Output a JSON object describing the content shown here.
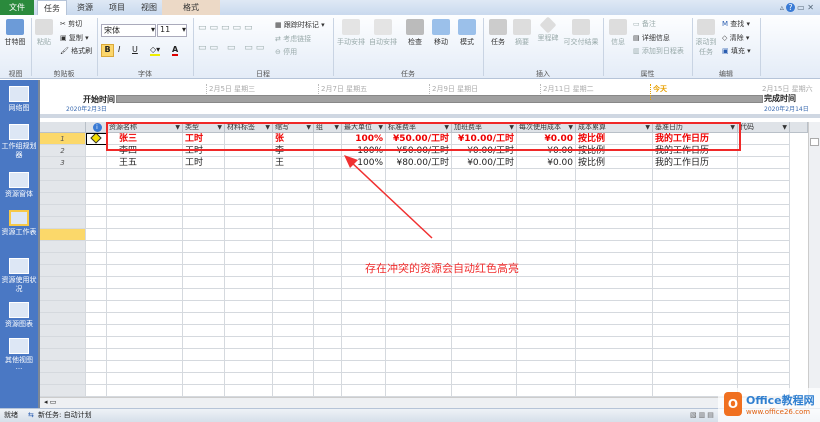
{
  "tabs": [
    "文件",
    "任务",
    "资源",
    "项目",
    "视图",
    "格式"
  ],
  "ribbon": {
    "gantt": "甘特图",
    "paste": "粘贴",
    "cut": "剪切",
    "copy": "复制",
    "format_painter": "格式刷",
    "font_name": "宋体",
    "font_size": "11",
    "bold": "B",
    "italic": "I",
    "underline": "U",
    "font_color": "A",
    "track": "跟踪时标记",
    "respect_links": "考虑链接",
    "inactivate": "停用",
    "manual": "手动安排",
    "auto": "自动安排",
    "inspect": "检查",
    "move": "移动",
    "mode": "模式",
    "task": "任务",
    "summary": "摘要",
    "milestone": "里程碑",
    "deliverable": "可交付结果",
    "info": "信息",
    "notes": "备注",
    "details": "详细信息",
    "add_timeline": "添加到日程表",
    "scroll_to": "滚动到任务",
    "find": "查找",
    "clear": "清除",
    "fill": "填充",
    "groups": [
      "视图",
      "剪贴板",
      "字体",
      "日程",
      "任务",
      "插入",
      "属性",
      "编辑"
    ]
  },
  "timeline": {
    "start_label": "开始时间",
    "start_date": "2020年2月3日",
    "finish_label": "完成时间",
    "finish_date": "2020年2月14日",
    "today": "今天",
    "ticks": [
      "2月5日 星期三",
      "2月7日 星期五",
      "2月9日 星期日",
      "2月11日 星期二",
      "2月15日 星期六"
    ]
  },
  "nav": [
    "网络图",
    "工作组规划器",
    "资源窗体",
    "资源工作表",
    "资源使用状况",
    "资源图表",
    "其他视图"
  ],
  "columns": [
    "资源名称",
    "类型",
    "材料标签",
    "缩写",
    "组",
    "最大单位",
    "标准费率",
    "加班费率",
    "每次使用成本",
    "成本累算",
    "基准日历",
    "代码"
  ],
  "rows": [
    {
      "id": "1",
      "name": "张三",
      "type": "工时",
      "material": "",
      "initials": "张",
      "group": "",
      "max": "100%",
      "std": "¥50.00/工时",
      "ovt": "¥10.00/工时",
      "cost": "¥0.00",
      "accrue": "按比例",
      "cal": "我的工作日历",
      "code": "",
      "conflict": true
    },
    {
      "id": "2",
      "name": "李四",
      "type": "工时",
      "material": "",
      "initials": "李",
      "group": "",
      "max": "100%",
      "std": "¥50.00/工时",
      "ovt": "¥0.00/工时",
      "cost": "¥0.00",
      "accrue": "按比例",
      "cal": "我的工作日历",
      "code": ""
    },
    {
      "id": "3",
      "name": "王五",
      "type": "工时",
      "material": "",
      "initials": "王",
      "group": "",
      "max": "100%",
      "std": "¥80.00/工时",
      "ovt": "¥0.00/工时",
      "cost": "¥0.00",
      "accrue": "按比例",
      "cal": "我的工作日历",
      "code": ""
    }
  ],
  "annotation": "存在冲突的资源会自动红色高亮",
  "status": {
    "ready": "就绪",
    "new_task": "新任务: 自动计划"
  },
  "watermark": {
    "brand": "Office教程网",
    "url": "www.office26.com"
  }
}
